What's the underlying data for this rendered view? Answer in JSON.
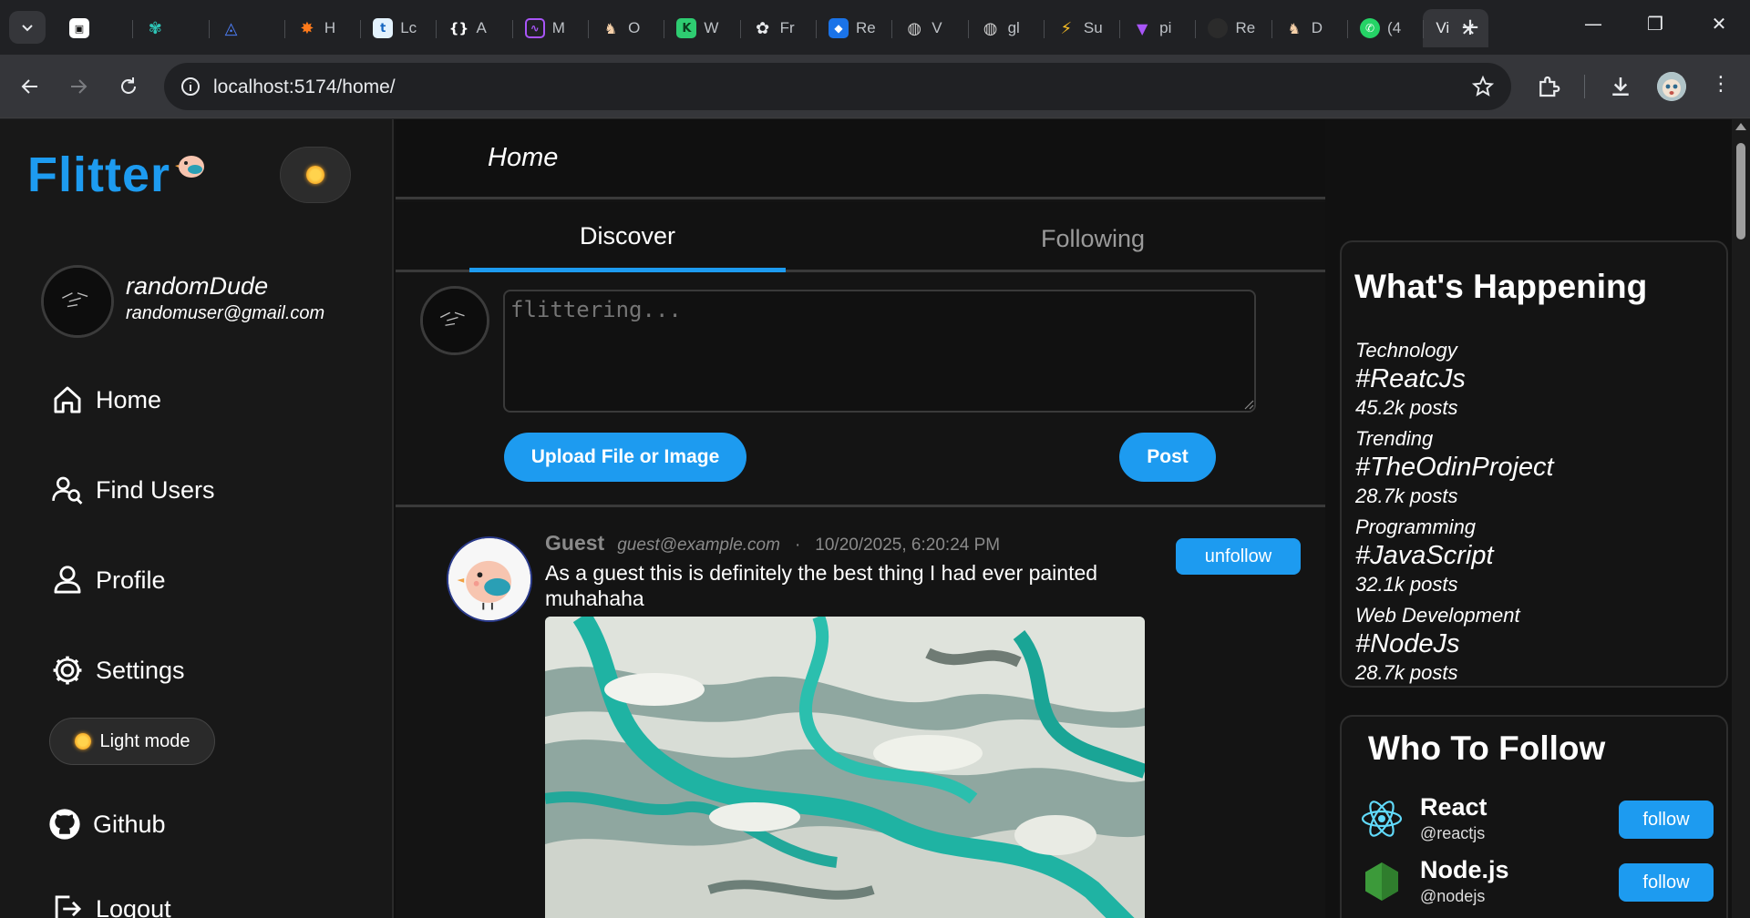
{
  "browser": {
    "tabs": [
      {
        "label": "",
        "icon": "video-tab-icon",
        "color": "#ffffff"
      },
      {
        "label": "",
        "icon": "paw-icon",
        "color": "#2ec4b6"
      },
      {
        "label": "",
        "icon": "triangle-logo-icon",
        "color": "#4c7cf3"
      },
      {
        "label": "H",
        "icon": "burst-icon",
        "color": "#ff7a1a"
      },
      {
        "label": "Lc",
        "icon": "t-letter-icon",
        "color": "#e3f2fd"
      },
      {
        "label": "A",
        "icon": "braces-icon",
        "color": "#2b2b2b"
      },
      {
        "label": "M",
        "icon": "chart-icon",
        "color": "#7c3aed"
      },
      {
        "label": "O",
        "icon": "bird-icon",
        "color": "#f5d0a9"
      },
      {
        "label": "W",
        "icon": "k-letter-icon",
        "color": "#2ecc71"
      },
      {
        "label": "Fr",
        "icon": "openai-icon",
        "color": "#cfcfcf"
      },
      {
        "label": "Re",
        "icon": "bookmark-icon",
        "color": "#1a73e8"
      },
      {
        "label": "V",
        "icon": "globe-icon",
        "color": "#cfcfcf"
      },
      {
        "label": "gl",
        "icon": "globe-icon",
        "color": "#cfcfcf"
      },
      {
        "label": "Su",
        "icon": "bolt-icon",
        "color": "#fbbf24"
      },
      {
        "label": "pi",
        "icon": "vite-icon",
        "color": "#a855f7"
      },
      {
        "label": "Re",
        "icon": "github-icon",
        "color": "#222222"
      },
      {
        "label": "D",
        "icon": "bird-icon",
        "color": "#f5d0a9"
      },
      {
        "label": "(4",
        "icon": "whatsapp-icon",
        "color": "#25d366"
      }
    ],
    "active_tab": {
      "label": "Vi"
    },
    "url": "localhost:5174/home/"
  },
  "sidebar": {
    "logo": "Flitter",
    "user": {
      "name": "randomDude",
      "email": "randomuser@gmail.com"
    },
    "nav": [
      {
        "label": "Home",
        "icon": "home-icon"
      },
      {
        "label": "Find Users",
        "icon": "find-users-icon"
      },
      {
        "label": "Profile",
        "icon": "user-icon"
      },
      {
        "label": "Settings",
        "icon": "gear-icon"
      }
    ],
    "light_mode_label": "Light mode",
    "github_label": "Github",
    "logout_label": "Logout"
  },
  "main": {
    "title": "Home",
    "tabs": [
      {
        "label": "Discover",
        "active": true
      },
      {
        "label": "Following",
        "active": false
      }
    ],
    "composer": {
      "placeholder": "flittering...",
      "upload_label": "Upload File or Image",
      "post_label": "Post"
    },
    "post": {
      "author": "Guest",
      "email": "guest@example.com",
      "separator": "·",
      "timestamp": "10/20/2025, 6:20:24 PM",
      "text": "As a guest this is definitely the best thing I had ever painted muhahaha",
      "action_label": "unfollow"
    }
  },
  "right": {
    "happening_title": "What's Happening",
    "trends": [
      {
        "category": "Technology",
        "tag": "#ReatcJs",
        "count": "45.2k posts"
      },
      {
        "category": "Trending",
        "tag": "#TheOdinProject",
        "count": "28.7k posts"
      },
      {
        "category": "Programming",
        "tag": "#JavaScript",
        "count": "32.1k posts"
      },
      {
        "category": "Web Development",
        "tag": "#NodeJs",
        "count": "28.7k posts"
      }
    ],
    "follow_title": "Who To Follow",
    "suggestions": [
      {
        "name": "React",
        "handle": "@reactjs",
        "button": "follow"
      },
      {
        "name": "Node.js",
        "handle": "@nodejs",
        "button": "follow"
      }
    ]
  },
  "colors": {
    "accent": "#1d9bf0",
    "background": "#111111"
  }
}
